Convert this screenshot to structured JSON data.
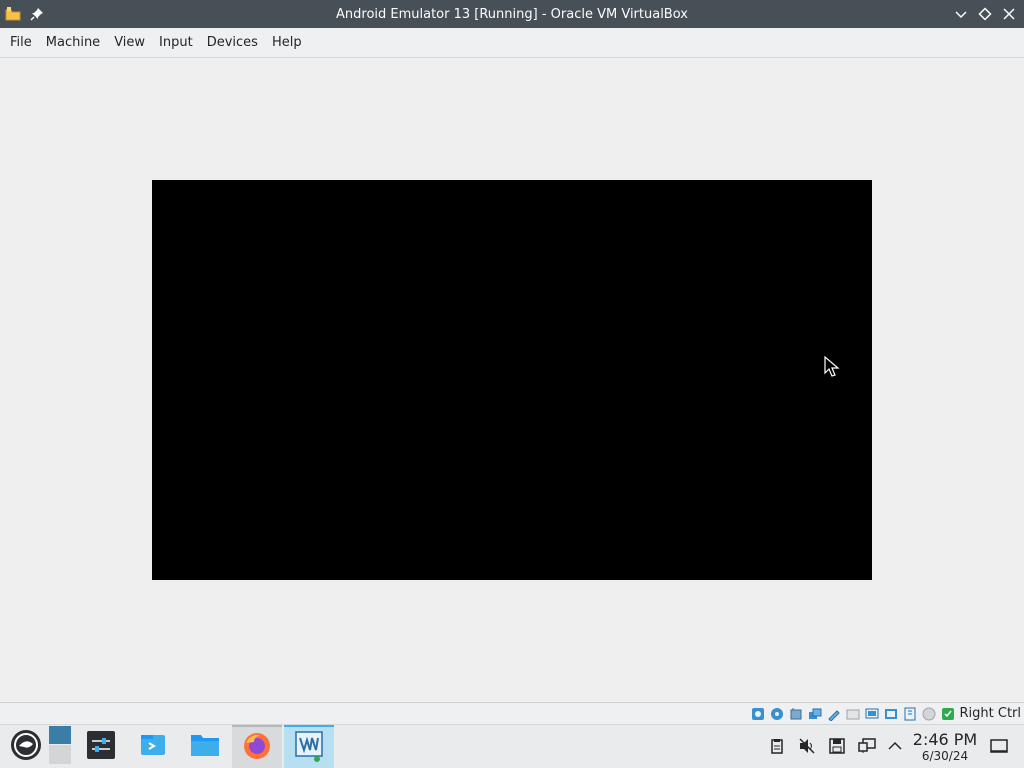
{
  "window": {
    "title": "Android Emulator 13 [Running] - Oracle VM VirtualBox",
    "app_icon": "virtualbox-folder-icon",
    "pin_icon": "pin-icon",
    "controls": [
      "minimize-chevron-icon",
      "maximize-diamond-icon",
      "close-x-icon"
    ]
  },
  "menubar": {
    "items": [
      {
        "label": "File"
      },
      {
        "label": "Machine"
      },
      {
        "label": "View"
      },
      {
        "label": "Input"
      },
      {
        "label": "Devices"
      },
      {
        "label": "Help"
      }
    ]
  },
  "vm": {
    "screen_color": "#000000",
    "cursor_icon": "mouse-pointer-icon"
  },
  "statusbar": {
    "indicators": [
      "hard-disk-icon",
      "optical-drive-icon",
      "audio-icon",
      "network-icon",
      "usb-icon",
      "shared-folders-icon",
      "display-icon",
      "video-capture-icon",
      "cpu-icon",
      "mouse-integration-icon",
      "keyboard-icon"
    ],
    "host_key": "Right Ctrl"
  },
  "taskbar": {
    "items": [
      {
        "name": "application-launcher",
        "icon": "opensuse-gecko-icon"
      },
      {
        "name": "pager",
        "icon": "virtual-desktop-pager-icon"
      },
      {
        "name": "system-settings",
        "icon": "settings-sliders-icon"
      },
      {
        "name": "discover",
        "icon": "terminal-arrow-icon"
      },
      {
        "name": "dolphin",
        "icon": "folder-icon"
      },
      {
        "name": "firefox",
        "icon": "firefox-icon"
      },
      {
        "name": "virtualbox",
        "icon": "virtualbox-vm-icon"
      }
    ],
    "tray": [
      "clipboard-icon",
      "volume-muted-icon",
      "save-disk-icon",
      "network-wired-icon",
      "show-hidden-chevron-icon"
    ],
    "clock": {
      "time": "2:46 PM",
      "date": "6/30/24"
    },
    "show_desktop_icon": "show-desktop-icon"
  },
  "colors": {
    "titlebar": "#475057",
    "taskbar_active": "#3daee9",
    "desktop": "#efeff0"
  }
}
